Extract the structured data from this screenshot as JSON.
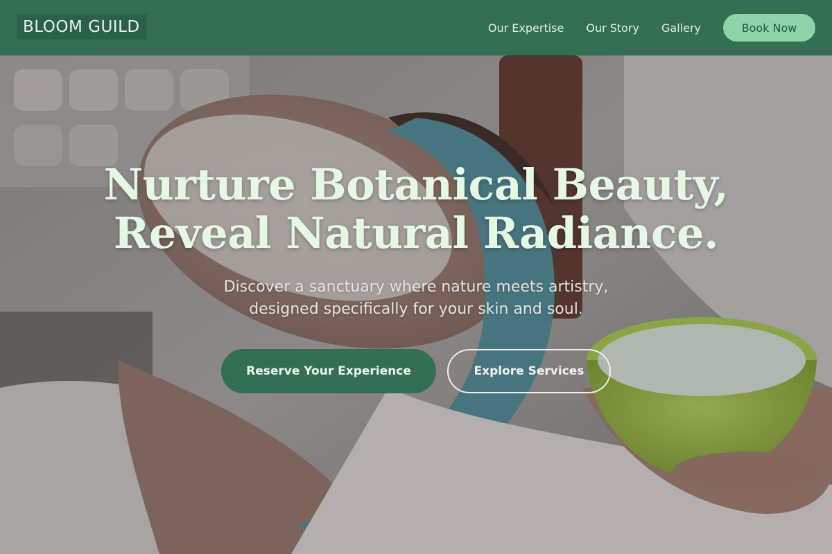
{
  "brand": {
    "name": "BLOOM GUILD"
  },
  "nav": {
    "links": [
      "Our Expertise",
      "Our Story",
      "Gallery"
    ],
    "book_label": "Book Now"
  },
  "hero": {
    "headline_line1": "Nurture Botanical Beauty,",
    "headline_line2": "Reveal Natural Radiance.",
    "subtitle_line1": "Discover a sanctuary where nature meets artistry,",
    "subtitle_line2": "designed specifically for your skin and soul.",
    "primary_cta": "Reserve Your Experience",
    "secondary_cta": "Explore Services",
    "image": "spa-facial-photo"
  },
  "colors": {
    "brand_green": "#346e53",
    "mint_accent": "#8fd4a9",
    "headline_color": "#e4f8e4"
  }
}
